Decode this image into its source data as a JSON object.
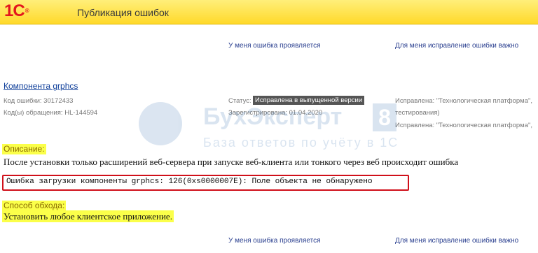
{
  "header": {
    "logo_text": "1С",
    "logo_reg": "®",
    "title": "Публикация ошибок"
  },
  "vote": {
    "has_error": "У меня ошибка проявляется",
    "fix_important": "Для меня исправление ошибки важно"
  },
  "component": {
    "title": "Компонента grphcs",
    "error_code": "Код ошибки: 30172433",
    "appeal_codes": "Код(ы) обращения: HL-144594",
    "status_label": "Статус:",
    "status_value": "Исправлена в выпущенной версии",
    "registered": "Зарегистрирована: 01.04.2020",
    "fixed_line1": "Исправлена: \"Технологическая платформа\",",
    "fixed_line2": "тестирования)",
    "fixed_line3": "Исправлена: \"Технологическая платформа\","
  },
  "watermark": {
    "name": "БухЭксперт",
    "number": "8",
    "tagline": "База ответов по учёту в 1С"
  },
  "description": {
    "label": "Описание:",
    "text": "После установки только расширений веб-сервера при запуске веб-клиента или тонкого через веб происходит ошибка",
    "error_message": "Ошибка загрузки компоненты grphcs: 126(0xs0000007E): Поле объекта не обнаружено"
  },
  "workaround": {
    "label": "Способ обхода:",
    "text": "Установить любое клиентское приложение."
  },
  "colors": {
    "header_yellow": "#ffd92a",
    "logo_red": "#e3161d",
    "highlight": "#fbff4a",
    "error_border": "#d0101a",
    "link_blue": "#0f3f9a"
  }
}
